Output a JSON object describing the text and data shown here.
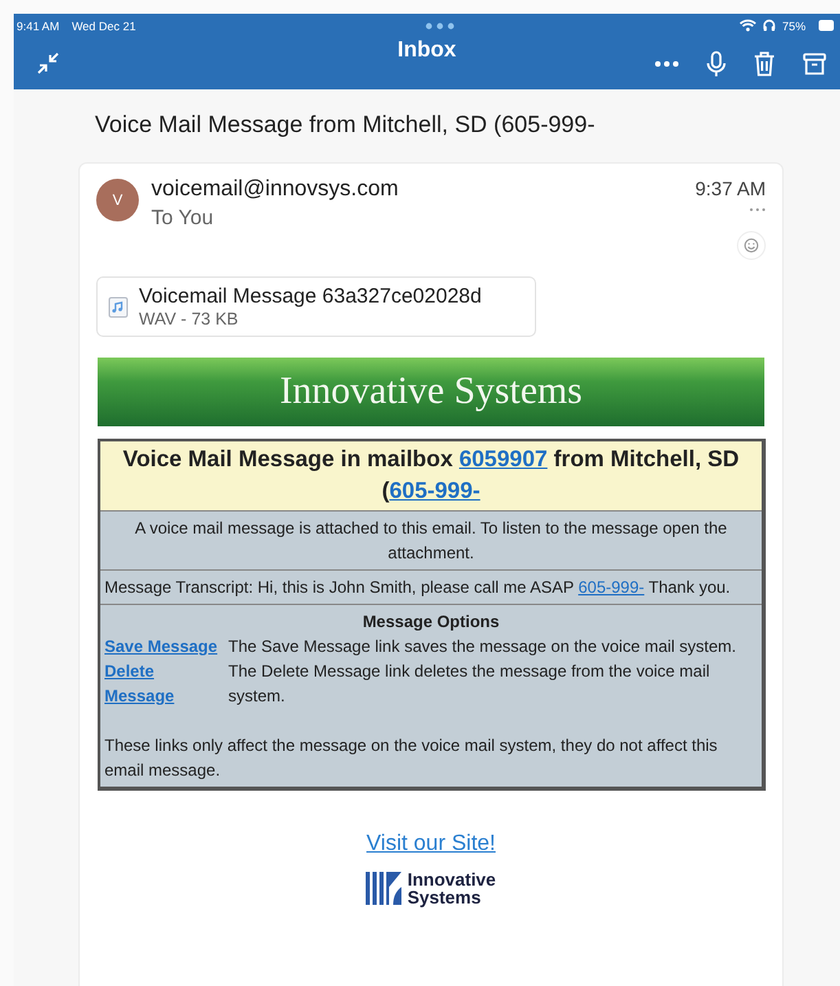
{
  "status_bar": {
    "time": "9:41 AM",
    "date": "Wed Dec 21",
    "battery": "75%"
  },
  "toolbar": {
    "title": "Inbox"
  },
  "subject": "Voice Mail Message from Mitchell, SD (605-999-",
  "message": {
    "avatar_initial": "V",
    "sender": "voicemail@innovsys.com",
    "recipient": "To You",
    "time": "9:37 AM",
    "attachment": {
      "name": "Voicemail Message 63a327ce02028d",
      "meta": "WAV - 73 KB"
    },
    "banner": "Innovative Systems",
    "heading": [
      {
        "kind": "text",
        "text": "Voice Mail Message in mailbox "
      },
      {
        "kind": "link",
        "text": "6059907"
      },
      {
        "kind": "text",
        "text": " from Mitchell, SD ("
      },
      {
        "kind": "link",
        "text": "605-999-"
      }
    ],
    "notice": "A voice mail message is attached to this email. To listen to the message open the attachment.",
    "transcript": [
      {
        "kind": "text",
        "text": "Message Transcript: Hi, this is John Smith, please call me ASAP "
      },
      {
        "kind": "link",
        "text": "605-999-"
      },
      {
        "kind": "text",
        "text": " Thank you."
      }
    ],
    "options_title": "Message Options",
    "options": [
      {
        "link": "Save Message",
        "description": "The Save Message link saves the message on the voice mail system."
      },
      {
        "link": "Delete Message",
        "description": "The Delete Message link deletes the message from the voice mail system."
      }
    ],
    "options_note": "These links only affect the message on the voice mail system, they do not affect this email message.",
    "visit_link": "Visit our Site!",
    "footer_logo": [
      "Innovative",
      "Systems"
    ]
  }
}
